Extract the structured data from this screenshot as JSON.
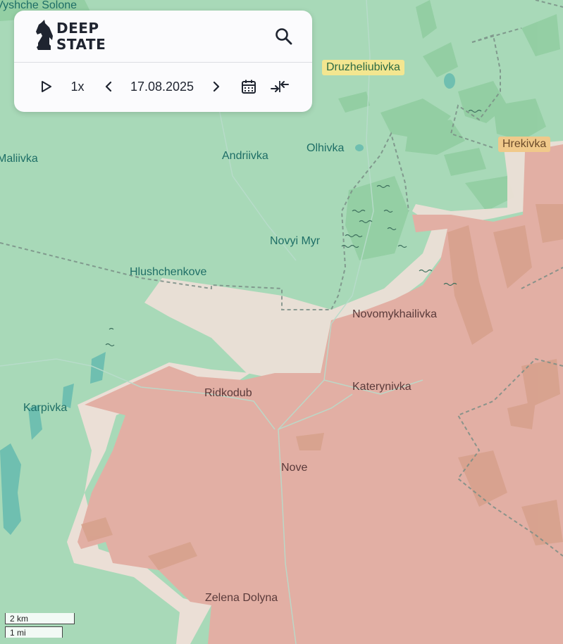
{
  "map": {
    "places": [
      {
        "id": "vyshche-solone",
        "label": "Vyshche Solone"
      },
      {
        "id": "druzheliubivka",
        "label": "Druzheliubivka"
      },
      {
        "id": "hrekivka",
        "label": "Hrekivka"
      },
      {
        "id": "maliivka",
        "label": "Maliivka"
      },
      {
        "id": "andriivka",
        "label": "Andriivka"
      },
      {
        "id": "olhivka",
        "label": "Olhivka"
      },
      {
        "id": "novyi-myr",
        "label": "Novyi Myr"
      },
      {
        "id": "hlushchenkove",
        "label": "Hlushchenkove"
      },
      {
        "id": "novomykhailivka",
        "label": "Novomykhailivka"
      },
      {
        "id": "ridkodub",
        "label": "Ridkodub"
      },
      {
        "id": "katerynivka",
        "label": "Katerynivka"
      },
      {
        "id": "karpivka",
        "label": "Karpivka"
      },
      {
        "id": "nove",
        "label": "Nove"
      },
      {
        "id": "zelena-dolyna",
        "label": "Zelena Dolyna"
      }
    ],
    "colors": {
      "background": "#a8d9b8",
      "forest": "#8fcb9f",
      "occupied": "#e2afa4",
      "contested": "#ebdfd6",
      "water": "#6fbfb0"
    }
  },
  "panel": {
    "logo_line1": "DEEP",
    "logo_line2": "STATE",
    "logo_icon": "knight-icon",
    "search_icon": "search-icon",
    "play_icon": "play-icon",
    "speed": "1x",
    "prev_icon": "chevron-left-icon",
    "date": "17.08.2025",
    "next_icon": "chevron-right-icon",
    "calendar_icon": "calendar-icon",
    "compare_icon": "compare-arrows-icon"
  },
  "scale": {
    "km": "2 km",
    "mi": "1 mi"
  }
}
